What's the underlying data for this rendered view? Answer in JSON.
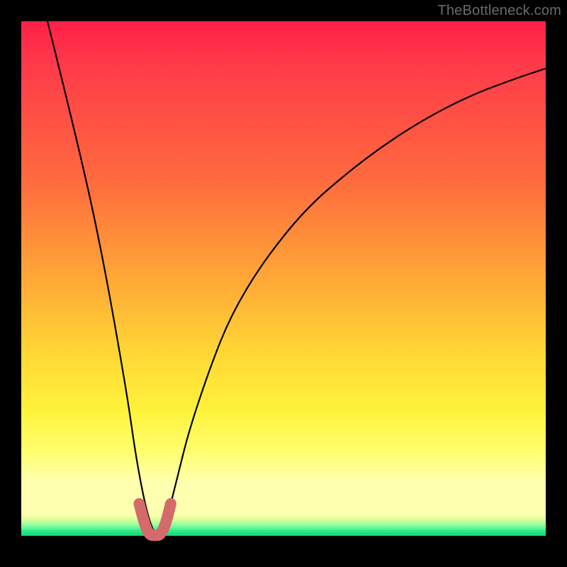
{
  "watermark": "TheBottleneck.com",
  "chart_data": {
    "type": "line",
    "title": "",
    "xlabel": "",
    "ylabel": "",
    "xlim": [
      0,
      100
    ],
    "ylim": [
      0,
      100
    ],
    "grid": false,
    "legend": false,
    "series": [
      {
        "name": "bottleneck-curve",
        "color": "#000000",
        "x": [
          5,
          10,
          15,
          20,
          22,
          24,
          25.5,
          27,
          28,
          30,
          32,
          36,
          40,
          46,
          54,
          62,
          70,
          78,
          86,
          94,
          100
        ],
        "values": [
          100,
          80,
          58,
          30,
          16,
          6,
          2,
          2,
          6,
          14,
          22,
          34,
          44,
          54,
          64,
          71,
          77,
          82,
          86,
          89,
          91
        ]
      },
      {
        "name": "highlight-dip",
        "color": "#d46a6a",
        "x": [
          22.5,
          23.5,
          24.5,
          25.5,
          26.5,
          27.5,
          28.5
        ],
        "values": [
          8,
          4,
          2,
          2,
          2,
          4,
          8
        ]
      }
    ],
    "gradient_stops": [
      {
        "pos": 0,
        "color": "#ff1f47"
      },
      {
        "pos": 30,
        "color": "#ff6a3e"
      },
      {
        "pos": 62,
        "color": "#ffd335"
      },
      {
        "pos": 88,
        "color": "#ffffb0"
      },
      {
        "pos": 96,
        "color": "#23e884"
      }
    ]
  }
}
